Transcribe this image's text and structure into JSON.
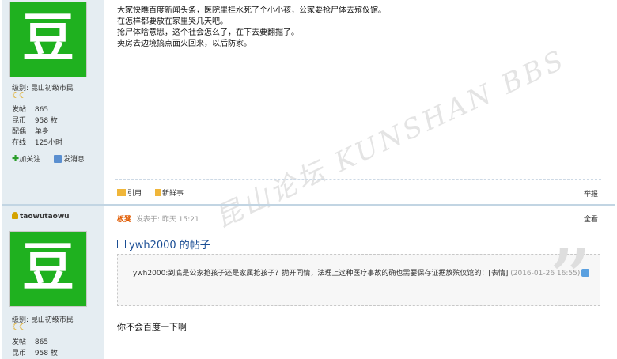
{
  "post1": {
    "avatar_char": "豆",
    "level": "级别: 昆山初级市民",
    "moons": "☾☾",
    "stats": [
      {
        "k": "发帖",
        "v": "865"
      },
      {
        "k": "昆币",
        "v": "958 枚"
      },
      {
        "k": "配偶",
        "v": "单身"
      },
      {
        "k": "在线",
        "v": "125小时"
      }
    ],
    "follow_label": "加关注",
    "message_label": "发消息",
    "body": [
      "大家快瞧百度新闻头条，医院里挂水死了个小小孩，公家要抢尸体去殡仪馆。",
      "在怎样都要放在家里哭几天吧。",
      "抢尸体啥意思，这个社会怎么了，在下去要翻掘了。",
      "卖房去边境搞点面火回来，以后防家。"
    ],
    "quote_btn": "引用",
    "fresh_btn": "新鲜事",
    "report_btn": "举报"
  },
  "watermark": "昆山论坛 KUNSHAN BBS",
  "post2": {
    "username": "taowutaowu",
    "flag": "板凳",
    "posted": "发表于: 昨天 15:21",
    "view_all": "全看",
    "title": "ywh2000 的帖子",
    "quote_text": "ywh2000:到底是公家抢孩子还是家属抢孩子？抛开同情，法理上这种医疗事故的确也需要保存证据放殡仪馆的！[表情]",
    "quote_time": "(2016-01-26 16:55)",
    "reply": "你不会百度一下啊",
    "avatar_char": "豆",
    "level": "级别: 昆山初级市民",
    "moons": "☾☾",
    "stats": [
      {
        "k": "发帖",
        "v": "865"
      },
      {
        "k": "昆币",
        "v": "958 枚"
      }
    ]
  }
}
